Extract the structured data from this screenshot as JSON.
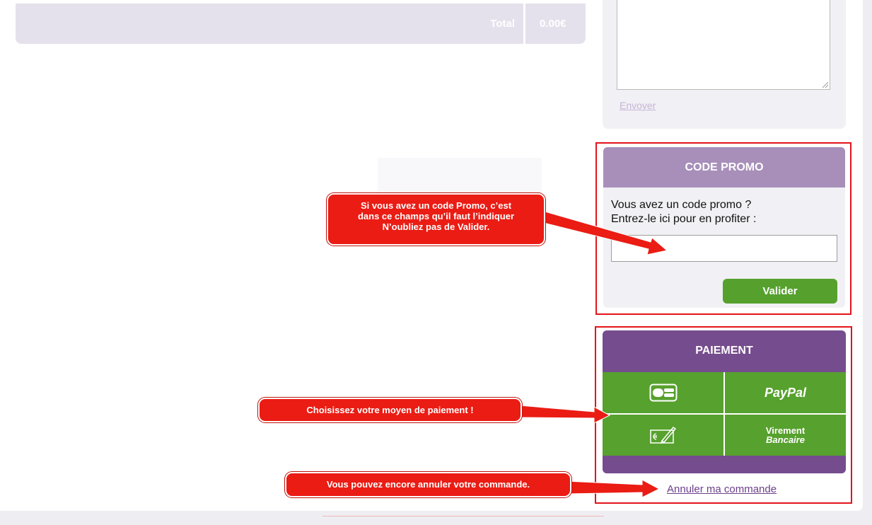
{
  "cart": {
    "total_label": "Total",
    "total_value": "0.00€"
  },
  "message": {
    "send_link": "Envoyer"
  },
  "promo": {
    "title": "CODE PROMO",
    "line1": "Vous avez un code promo ?",
    "line2": "Entrez-le ici pour en profiter :",
    "input_value": "",
    "validate_label": "Valider"
  },
  "payment": {
    "title": "PAIEMENT",
    "methods": [
      {
        "icon": "cb-card-icon"
      },
      {
        "label": "PayPal"
      },
      {
        "icon": "cheque-icon"
      },
      {
        "label_line1": "Virement",
        "label_line2": "Bancaire"
      }
    ],
    "cancel_link": "Annuler ma commande"
  },
  "callouts": {
    "promo_line1": "Si vous avez un code Promo, c’est",
    "promo_line2": "dans ce champs qu’il faut l’indiquer",
    "promo_line3": "N’oubliez pas de Valider.",
    "payment": "Choisissez votre moyen de paiement !",
    "cancel": "Vous pouvez encore annuler votre commande."
  },
  "colors": {
    "promo_header": "#a78fba",
    "payment_header": "#754c8d",
    "action_green": "#56a12e",
    "highlight_red": "#e3141b"
  }
}
